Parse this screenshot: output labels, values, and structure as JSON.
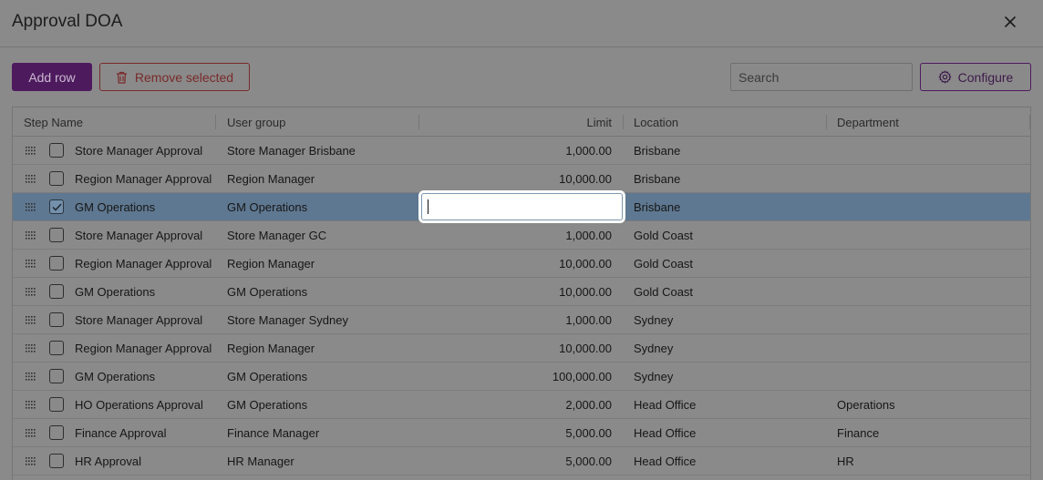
{
  "dialog": {
    "title": "Approval DOA"
  },
  "toolbar": {
    "add_label": "Add row",
    "remove_label": "Remove selected",
    "search_placeholder": "Search",
    "configure_label": "Configure"
  },
  "columns": [
    "Step Name",
    "User group",
    "Limit",
    "Location",
    "Department"
  ],
  "rows": [
    {
      "step": "Store Manager Approval",
      "group": "Store Manager Brisbane",
      "limit": "1,000.00",
      "location": "Brisbane",
      "department": "",
      "checked": false,
      "editing": false
    },
    {
      "step": "Region Manager Approval",
      "group": "Region Manager",
      "limit": "10,000.00",
      "location": "Brisbane",
      "department": "",
      "checked": false,
      "editing": false
    },
    {
      "step": "GM Operations",
      "group": "GM Operations",
      "limit": "",
      "location": "Brisbane",
      "department": "",
      "checked": true,
      "editing": true
    },
    {
      "step": "Store Manager Approval",
      "group": "Store Manager GC",
      "limit": "1,000.00",
      "location": "Gold Coast",
      "department": "",
      "checked": false,
      "editing": false
    },
    {
      "step": "Region Manager Approval",
      "group": "Region Manager",
      "limit": "10,000.00",
      "location": "Gold Coast",
      "department": "",
      "checked": false,
      "editing": false
    },
    {
      "step": "GM Operations",
      "group": "GM Operations",
      "limit": "10,000.00",
      "location": "Gold Coast",
      "department": "",
      "checked": false,
      "editing": false
    },
    {
      "step": "Store Manager Approval",
      "group": "Store Manager Sydney",
      "limit": "1,000.00",
      "location": "Sydney",
      "department": "",
      "checked": false,
      "editing": false
    },
    {
      "step": "Region Manager Approval",
      "group": "Region Manager",
      "limit": "10,000.00",
      "location": "Sydney",
      "department": "",
      "checked": false,
      "editing": false
    },
    {
      "step": "GM Operations",
      "group": "GM Operations",
      "limit": "100,000.00",
      "location": "Sydney",
      "department": "",
      "checked": false,
      "editing": false
    },
    {
      "step": "HO Operations Approval",
      "group": "GM Operations",
      "limit": "2,000.00",
      "location": "Head Office",
      "department": "Operations",
      "checked": false,
      "editing": false
    },
    {
      "step": "Finance Approval",
      "group": "Finance Manager",
      "limit": "5,000.00",
      "location": "Head Office",
      "department": "Finance",
      "checked": false,
      "editing": false
    },
    {
      "step": "HR Approval",
      "group": "HR Manager",
      "limit": "5,000.00",
      "location": "Head Office",
      "department": "HR",
      "checked": false,
      "editing": false
    }
  ],
  "icons": {
    "close": "close-icon",
    "trash": "trash-icon",
    "gear": "gear-icon",
    "drag": "drag-handle-icon",
    "check": "check-icon"
  },
  "colors": {
    "primary": "#4e1a5e",
    "danger": "#7a2a2a",
    "selected_row": "#5f7891"
  }
}
